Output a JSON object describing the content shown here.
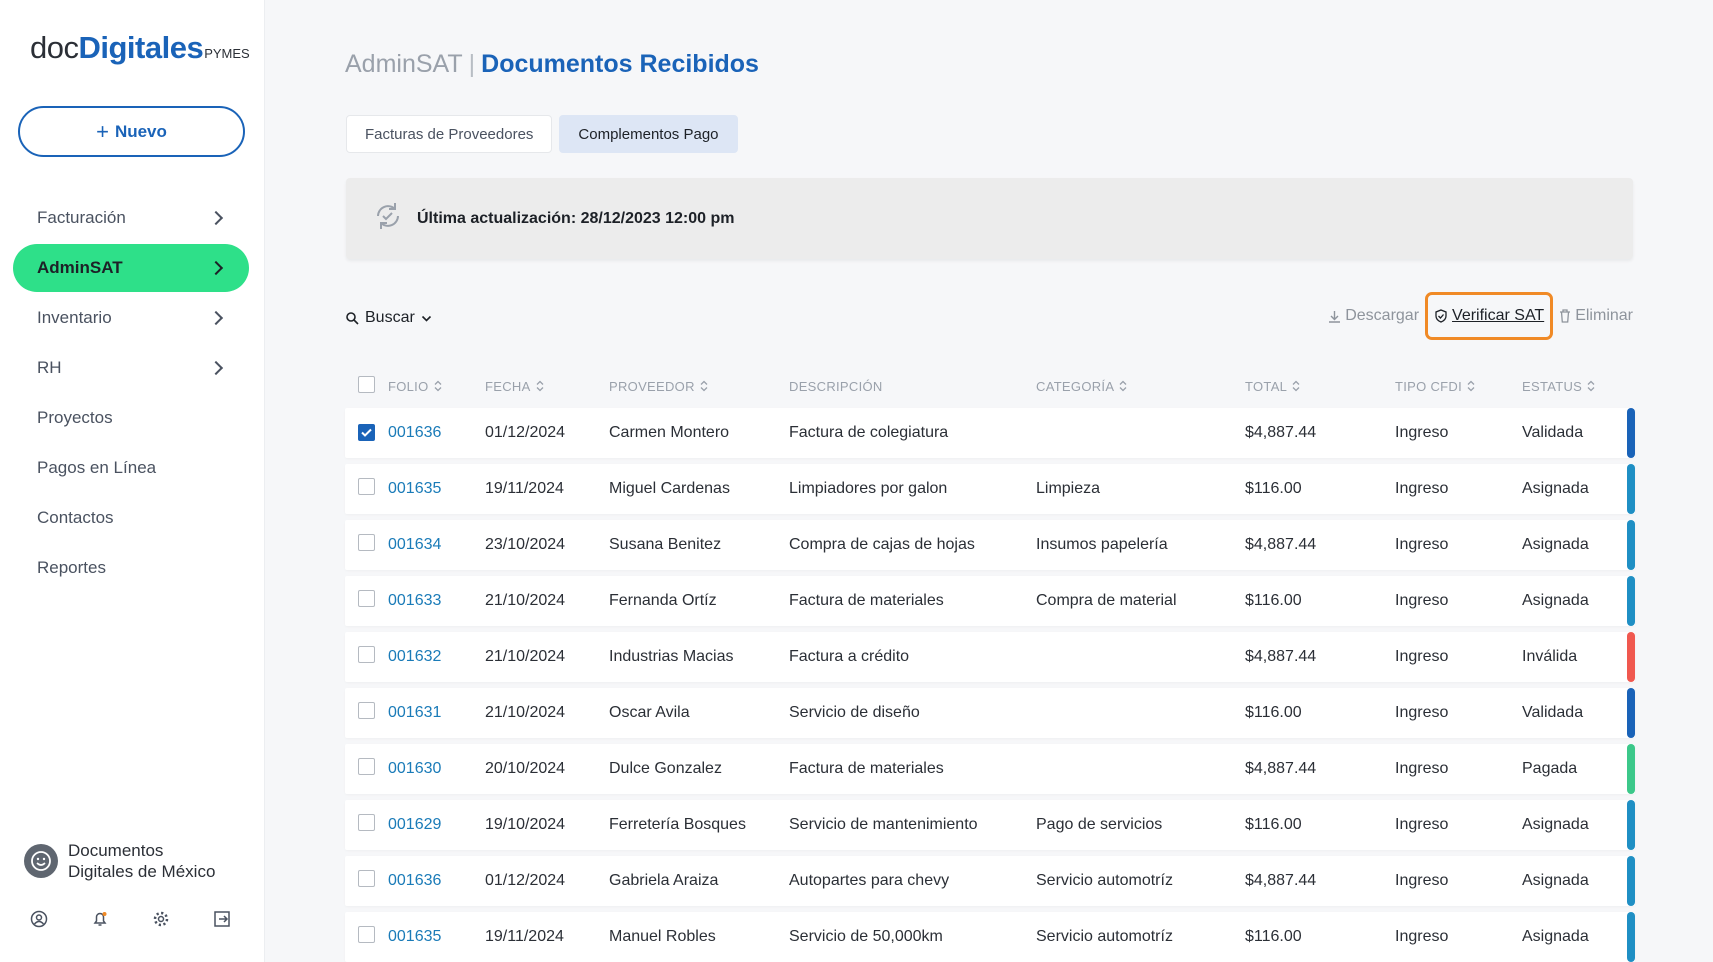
{
  "brand": {
    "doc": "doc",
    "digitales": "Digitales",
    "pymes": "PYMES"
  },
  "new_button": {
    "label": "Nuevo"
  },
  "sidebar": {
    "items": [
      {
        "label": "Facturación",
        "has_chevron": true,
        "active": false
      },
      {
        "label": "AdminSAT",
        "has_chevron": true,
        "active": true
      },
      {
        "label": "Inventario",
        "has_chevron": true,
        "active": false
      },
      {
        "label": "RH",
        "has_chevron": true,
        "active": false
      },
      {
        "label": "Proyectos",
        "has_chevron": false,
        "active": false
      },
      {
        "label": "Pagos en Línea",
        "has_chevron": false,
        "active": false
      },
      {
        "label": "Contactos",
        "has_chevron": false,
        "active": false
      },
      {
        "label": "Reportes",
        "has_chevron": false,
        "active": false
      }
    ],
    "company": {
      "line1": "Documentos",
      "line2": "Digitales de México"
    },
    "footer_icons": [
      "user-icon",
      "bell-icon",
      "gear-icon",
      "logout-icon"
    ]
  },
  "header": {
    "section": "AdminSAT",
    "separator": "|",
    "title": "Documentos Recibidos"
  },
  "tabs": [
    {
      "label": "Facturas de Proveedores",
      "active": false
    },
    {
      "label": "Complementos Pago",
      "active": true
    }
  ],
  "update": {
    "text": "Última actualización: 28/12/2023 12:00 pm"
  },
  "toolbar": {
    "search_label": "Buscar",
    "download_label": "Descargar",
    "verify_label": "Verificar SAT",
    "delete_label": "Eliminar"
  },
  "table": {
    "columns": [
      "FOLIO",
      "FECHA",
      "PROVEEDOR",
      "DESCRIPCIÓN",
      "CATEGORÍA",
      "TOTAL",
      "TIPO CFDI",
      "ESTATUS"
    ],
    "rows": [
      {
        "checked": true,
        "folio": "001636",
        "fecha": "01/12/2024",
        "proveedor": "Carmen Montero",
        "descripcion": "Factura de colegiatura",
        "categoria": "",
        "total": "$4,887.44",
        "tipo": "Ingreso",
        "estatus": "Validada",
        "color": "#1a63b8"
      },
      {
        "checked": false,
        "folio": "001635",
        "fecha": "19/11/2024",
        "proveedor": "Miguel Cardenas",
        "descripcion": "Limpiadores por galon",
        "categoria": "Limpieza",
        "total": "$116.00",
        "tipo": "Ingreso",
        "estatus": "Asignada",
        "color": "#1f8fc4"
      },
      {
        "checked": false,
        "folio": "001634",
        "fecha": "23/10/2024",
        "proveedor": "Susana Benitez",
        "descripcion": "Compra de cajas de hojas",
        "categoria": "Insumos papelería",
        "total": "$4,887.44",
        "tipo": "Ingreso",
        "estatus": "Asignada",
        "color": "#1f8fc4"
      },
      {
        "checked": false,
        "folio": "001633",
        "fecha": "21/10/2024",
        "proveedor": "Fernanda Ortíz",
        "descripcion": "Factura de materiales",
        "categoria": "Compra de material",
        "total": "$116.00",
        "tipo": "Ingreso",
        "estatus": "Asignada",
        "color": "#1f8fc4"
      },
      {
        "checked": false,
        "folio": "001632",
        "fecha": "21/10/2024",
        "proveedor": "Industrias Macias",
        "descripcion": "Factura a crédito",
        "categoria": "",
        "total": "$4,887.44",
        "tipo": "Ingreso",
        "estatus": "Inválida",
        "color": "#f0584f"
      },
      {
        "checked": false,
        "folio": "001631",
        "fecha": "21/10/2024",
        "proveedor": "Oscar Avila",
        "descripcion": "Servicio de diseño",
        "categoria": "",
        "total": "$116.00",
        "tipo": "Ingreso",
        "estatus": "Validada",
        "color": "#1a63b8"
      },
      {
        "checked": false,
        "folio": "001630",
        "fecha": "20/10/2024",
        "proveedor": "Dulce Gonzalez",
        "descripcion": "Factura de materiales",
        "categoria": "",
        "total": "$4,887.44",
        "tipo": "Ingreso",
        "estatus": "Pagada",
        "color": "#3cc88a"
      },
      {
        "checked": false,
        "folio": "001629",
        "fecha": "19/10/2024",
        "proveedor": "Ferretería Bosques",
        "descripcion": "Servicio de mantenimiento",
        "categoria": "Pago de servicios",
        "total": "$116.00",
        "tipo": "Ingreso",
        "estatus": "Asignada",
        "color": "#1f8fc4"
      },
      {
        "checked": false,
        "folio": "001636",
        "fecha": "01/12/2024",
        "proveedor": "Gabriela Araiza",
        "descripcion": "Autopartes para chevy",
        "categoria": "Servicio automotríz",
        "total": "$4,887.44",
        "tipo": "Ingreso",
        "estatus": "Asignada",
        "color": "#1f8fc4"
      },
      {
        "checked": false,
        "folio": "001635",
        "fecha": "19/11/2024",
        "proveedor": "Manuel Robles",
        "descripcion": "Servicio de 50,000km",
        "categoria": "Servicio automotríz",
        "total": "$116.00",
        "tipo": "Ingreso",
        "estatus": "Asignada",
        "color": "#1f8fc4"
      }
    ]
  }
}
